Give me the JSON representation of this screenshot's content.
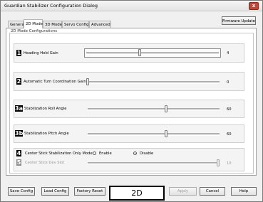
{
  "window": {
    "title": "Guardian Stabilizer Configuration Dialog",
    "close_label": "x"
  },
  "tabs": [
    {
      "label": "General"
    },
    {
      "label": "2D Mode"
    },
    {
      "label": "3D Mode"
    },
    {
      "label": "Servo Config"
    },
    {
      "label": "Advanced"
    }
  ],
  "firmware_button": "Firmware Update",
  "group_title": "2D Mode Configurations",
  "settings": [
    {
      "marker": "1",
      "label": "Heading Hold Gain",
      "value": "4",
      "slider_fraction": 0.4
    },
    {
      "marker": "2",
      "label": "Automatic Turn Coordination  Gain",
      "value": "0",
      "slider_fraction": 0.0
    },
    {
      "marker": "3a",
      "label": "Stabilization Roll Angle",
      "value": "60",
      "slider_fraction": 0.6
    },
    {
      "marker": "3b",
      "label": "Stabilization Pitch Angle",
      "value": "60",
      "slider_fraction": 0.6
    }
  ],
  "center_stick": {
    "marker": "4",
    "label": "Center Stick Stabilization Only Mode",
    "enable_label": "Enable",
    "disable_label": "Disable",
    "selected": "Disable"
  },
  "dead_band": {
    "marker": "5",
    "label": "Center Stick Dev Slot",
    "value": "10",
    "slider_fraction": 1.0
  },
  "buttons": {
    "save": "Save Config",
    "load": "Load Config",
    "factory_reset": "Factory Reset",
    "apply": "Apply",
    "cancel": "Cancel",
    "help": "Help"
  },
  "mode_indicator": "2D"
}
